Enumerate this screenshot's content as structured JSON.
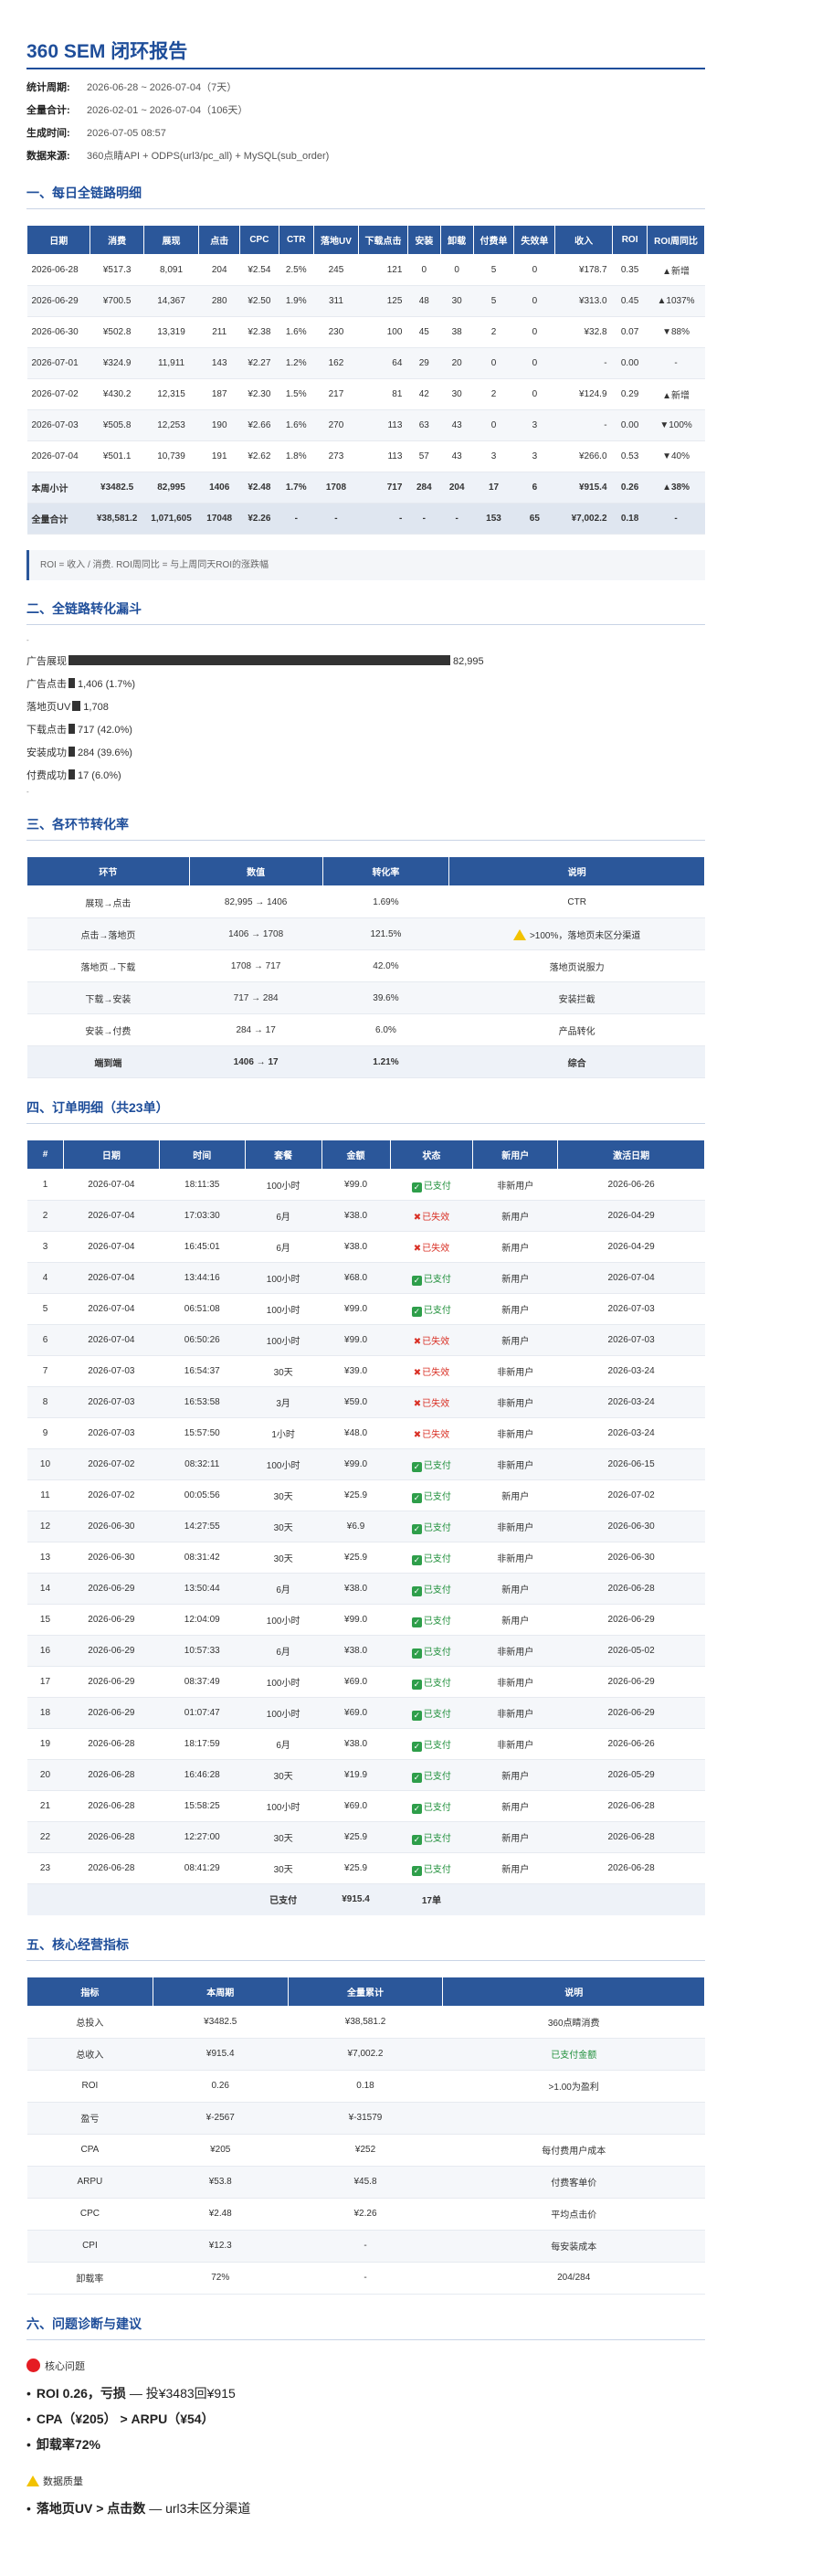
{
  "title": "360 SEM 闭环报告",
  "meta": [
    {
      "label": "统计周期:",
      "value": "2026-06-28 ~ 2026-07-04（7天）"
    },
    {
      "label": "全量合计:",
      "value": "2026-02-01 ~ 2026-07-04（106天）"
    },
    {
      "label": "生成时间:",
      "value": "2026-07-05 08:57"
    },
    {
      "label": "数据来源:",
      "value": "360点睛API + ODPS(url3/pc_all) + MySQL(sub_order)"
    }
  ],
  "sec1": {
    "title": "一、每日全链路明细",
    "headers": [
      "日期",
      "消费",
      "展现",
      "点击",
      "CPC",
      "CTR",
      "落地UV",
      "下载点击",
      "安装",
      "卸载",
      "付费单",
      "失效单",
      "收入",
      "ROI",
      "ROI周同比"
    ],
    "rows": [
      [
        "2026-06-28",
        "¥517.3",
        "8,091",
        "204",
        "¥2.54",
        "2.5%",
        "245",
        "121",
        "0",
        "0",
        "5",
        "0",
        "¥178.7",
        "0.35",
        "▲新增"
      ],
      [
        "2026-06-29",
        "¥700.5",
        "14,367",
        "280",
        "¥2.50",
        "1.9%",
        "311",
        "125",
        "48",
        "30",
        "5",
        "0",
        "¥313.0",
        "0.45",
        "▲1037%"
      ],
      [
        "2026-06-30",
        "¥502.8",
        "13,319",
        "211",
        "¥2.38",
        "1.6%",
        "230",
        "100",
        "45",
        "38",
        "2",
        "0",
        "¥32.8",
        "0.07",
        "▼88%"
      ],
      [
        "2026-07-01",
        "¥324.9",
        "11,911",
        "143",
        "¥2.27",
        "1.2%",
        "162",
        "64",
        "29",
        "20",
        "0",
        "0",
        "-",
        "0.00",
        "-"
      ],
      [
        "2026-07-02",
        "¥430.2",
        "12,315",
        "187",
        "¥2.30",
        "1.5%",
        "217",
        "81",
        "42",
        "30",
        "2",
        "0",
        "¥124.9",
        "0.29",
        "▲新增"
      ],
      [
        "2026-07-03",
        "¥505.8",
        "12,253",
        "190",
        "¥2.66",
        "1.6%",
        "270",
        "113",
        "63",
        "43",
        "0",
        "3",
        "-",
        "0.00",
        "▼100%"
      ],
      [
        "2026-07-04",
        "¥501.1",
        "10,739",
        "191",
        "¥2.62",
        "1.8%",
        "273",
        "113",
        "57",
        "43",
        "3",
        "3",
        "¥266.0",
        "0.53",
        "▼40%"
      ]
    ],
    "subtotal": [
      "本周小计",
      "¥3482.5",
      "82,995",
      "1406",
      "¥2.48",
      "1.7%",
      "1708",
      "717",
      "284",
      "204",
      "17",
      "6",
      "¥915.4",
      "0.26",
      "▲38%"
    ],
    "total": [
      "全量合计",
      "¥38,581.2",
      "1,071,605",
      "17048",
      "¥2.26",
      "-",
      "-",
      "-",
      "-",
      "-",
      "153",
      "65",
      "¥7,002.2",
      "0.18",
      "-"
    ],
    "note": "ROI = 收入 / 消费. ROI周同比 = 与上周同天ROI的涨跌幅"
  },
  "sec2": {
    "title": "二、全链路转化漏斗",
    "dot": "-",
    "rows": [
      {
        "label": "广告展现",
        "value": "82,995",
        "fraction": 1.0
      },
      {
        "label": "广告点击",
        "value": "1,406 (1.7%)",
        "fraction": 0.017
      },
      {
        "label": "落地页UV",
        "value": "1,708",
        "fraction": 0.021
      },
      {
        "label": "下载点击",
        "value": "717 (42.0%)",
        "fraction": 0.009
      },
      {
        "label": "安装成功",
        "value": "284 (39.6%)",
        "fraction": 0.003
      },
      {
        "label": "付费成功",
        "value": "17 (6.0%)",
        "fraction": 0.0002
      }
    ]
  },
  "sec3": {
    "title": "三、各环节转化率",
    "headers": [
      "环节",
      "数值",
      "转化率",
      "说明"
    ],
    "rows": [
      [
        "展现→点击",
        "82,995 → 1406",
        "1.69%",
        "CTR"
      ],
      [
        "点击→落地页",
        "1406 → 1708",
        "121.5%",
        ">100%，落地页未区分渠道"
      ],
      [
        "落地页→下载",
        "1708 → 717",
        "42.0%",
        "落地页说服力"
      ],
      [
        "下载→安装",
        "717 → 284",
        "39.6%",
        "安装拦截"
      ],
      [
        "安装→付费",
        "284 → 17",
        "6.0%",
        "产品转化"
      ]
    ],
    "summary": [
      "端到端",
      "1406 → 17",
      "1.21%",
      "综合"
    ]
  },
  "sec4": {
    "title": "四、订单明细（共23单）",
    "headers": [
      "#",
      "日期",
      "时间",
      "套餐",
      "金额",
      "状态",
      "新用户",
      "激活日期"
    ],
    "status_paid": "已支付",
    "status_invalid": "已失效",
    "rows": [
      [
        "1",
        "2026-07-04",
        "18:11:35",
        "100小时",
        "¥99.0",
        "paid",
        "非新用户",
        "2026-06-26"
      ],
      [
        "2",
        "2026-07-04",
        "17:03:30",
        "6月",
        "¥38.0",
        "invalid",
        "新用户",
        "2026-04-29"
      ],
      [
        "3",
        "2026-07-04",
        "16:45:01",
        "6月",
        "¥38.0",
        "invalid",
        "新用户",
        "2026-04-29"
      ],
      [
        "4",
        "2026-07-04",
        "13:44:16",
        "100小时",
        "¥68.0",
        "paid",
        "新用户",
        "2026-07-04"
      ],
      [
        "5",
        "2026-07-04",
        "06:51:08",
        "100小时",
        "¥99.0",
        "paid",
        "新用户",
        "2026-07-03"
      ],
      [
        "6",
        "2026-07-04",
        "06:50:26",
        "100小时",
        "¥99.0",
        "invalid",
        "新用户",
        "2026-07-03"
      ],
      [
        "7",
        "2026-07-03",
        "16:54:37",
        "30天",
        "¥39.0",
        "invalid",
        "非新用户",
        "2026-03-24"
      ],
      [
        "8",
        "2026-07-03",
        "16:53:58",
        "3月",
        "¥59.0",
        "invalid",
        "非新用户",
        "2026-03-24"
      ],
      [
        "9",
        "2026-07-03",
        "15:57:50",
        "1小时",
        "¥48.0",
        "invalid",
        "非新用户",
        "2026-03-24"
      ],
      [
        "10",
        "2026-07-02",
        "08:32:11",
        "100小时",
        "¥99.0",
        "paid",
        "非新用户",
        "2026-06-15"
      ],
      [
        "11",
        "2026-07-02",
        "00:05:56",
        "30天",
        "¥25.9",
        "paid",
        "新用户",
        "2026-07-02"
      ],
      [
        "12",
        "2026-06-30",
        "14:27:55",
        "30天",
        "¥6.9",
        "paid",
        "非新用户",
        "2026-06-30"
      ],
      [
        "13",
        "2026-06-30",
        "08:31:42",
        "30天",
        "¥25.9",
        "paid",
        "非新用户",
        "2026-06-30"
      ],
      [
        "14",
        "2026-06-29",
        "13:50:44",
        "6月",
        "¥38.0",
        "paid",
        "新用户",
        "2026-06-28"
      ],
      [
        "15",
        "2026-06-29",
        "12:04:09",
        "100小时",
        "¥99.0",
        "paid",
        "新用户",
        "2026-06-29"
      ],
      [
        "16",
        "2026-06-29",
        "10:57:33",
        "6月",
        "¥38.0",
        "paid",
        "非新用户",
        "2026-05-02"
      ],
      [
        "17",
        "2026-06-29",
        "08:37:49",
        "100小时",
        "¥69.0",
        "paid",
        "非新用户",
        "2026-06-29"
      ],
      [
        "18",
        "2026-06-29",
        "01:07:47",
        "100小时",
        "¥69.0",
        "paid",
        "非新用户",
        "2026-06-29"
      ],
      [
        "19",
        "2026-06-28",
        "18:17:59",
        "6月",
        "¥38.0",
        "paid",
        "非新用户",
        "2026-06-26"
      ],
      [
        "20",
        "2026-06-28",
        "16:46:28",
        "30天",
        "¥19.9",
        "paid",
        "新用户",
        "2026-05-29"
      ],
      [
        "21",
        "2026-06-28",
        "15:58:25",
        "100小时",
        "¥69.0",
        "paid",
        "新用户",
        "2026-06-28"
      ],
      [
        "22",
        "2026-06-28",
        "12:27:00",
        "30天",
        "¥25.9",
        "paid",
        "新用户",
        "2026-06-28"
      ],
      [
        "23",
        "2026-06-28",
        "08:41:29",
        "30天",
        "¥25.9",
        "paid",
        "新用户",
        "2026-06-28"
      ]
    ],
    "footer": {
      "label": "已支付",
      "amount": "¥915.4",
      "count": "17单"
    }
  },
  "sec5": {
    "title": "五、核心经营指标",
    "headers": [
      "指标",
      "本周期",
      "全量累计",
      "说明"
    ],
    "rows": [
      [
        "总投入",
        "¥3482.5",
        "¥38,581.2",
        "360点睛消费"
      ],
      [
        "总收入",
        "¥915.4",
        "¥7,002.2",
        "已支付金额"
      ],
      [
        "ROI",
        "0.26",
        "0.18",
        ">1.00为盈利"
      ],
      [
        "盈亏",
        "¥-2567",
        "¥-31579",
        ""
      ],
      [
        "CPA",
        "¥205",
        "¥252",
        "每付费用户成本"
      ],
      [
        "ARPU",
        "¥53.8",
        "¥45.8",
        "付费客单价"
      ],
      [
        "CPC",
        "¥2.48",
        "¥2.26",
        "平均点击价"
      ],
      [
        "CPI",
        "¥12.3",
        "-",
        "每安装成本"
      ],
      [
        "卸载率",
        "72%",
        "-",
        "204/284"
      ]
    ]
  },
  "sec6": {
    "title": "六、问题诊断与建议",
    "core_title": "核心问题",
    "core_items": [
      {
        "bold": "ROI 0.26，亏损",
        "rest": " — 投¥3483回¥915"
      },
      {
        "bold": "CPA（¥205） > ARPU（¥54）",
        "rest": ""
      },
      {
        "bold": "卸载率72%",
        "rest": ""
      }
    ],
    "dq_title": "数据质量",
    "dq_items": [
      {
        "bold": "落地页UV > 点击数",
        "rest": " — url3未区分渠道"
      }
    ]
  },
  "colors": {
    "accent": "#1f4e9a",
    "header_bg": "#2b579a",
    "paid": "#1f8f3a",
    "invalid": "#d93025",
    "bar": "#333333"
  }
}
